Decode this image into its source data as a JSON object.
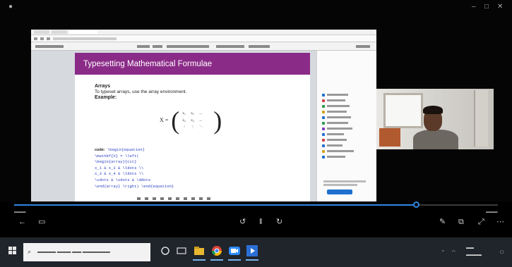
{
  "slide": {
    "title": "Typesetting Mathematical Formulae",
    "heading_arrays": "Arrays",
    "intro": "To typeset arrays, use the array environment.",
    "heading_example": "Example:",
    "matrix_label": "X =",
    "matrix_cells": [
      "x₁",
      "x₂",
      "...",
      "x₃",
      "x₄",
      "...",
      "⋮",
      "⋮",
      "⋱"
    ],
    "code_label": "code:",
    "code_lines": [
      "\\begin{equation}",
      "\\mathbf{X} = \\left(",
      "\\begin{array}{ccc}",
      "x_1 & x_2 & \\ldots \\\\",
      "x_3 & x_4 & \\ldots \\\\",
      "\\vdots & \\vdots & \\ddots",
      "\\end{array} \\right) \\end{equation}"
    ]
  },
  "player": {
    "progress_fraction": 0.83
  },
  "icons": {
    "back": "back-arrow-icon",
    "captions": "captions-icon",
    "rewind": "rewind-10-icon",
    "play_pause": "pause-icon",
    "forward": "forward-30-icon",
    "edit": "pen-icon",
    "miniplayer": "miniplayer-icon",
    "fullscreen": "fullscreen-icon",
    "more": "more-icon"
  },
  "colors": {
    "slide_title_bar": "#8b2b88",
    "seek_fill": "#2f86e0",
    "taskbar": "#20242b"
  }
}
